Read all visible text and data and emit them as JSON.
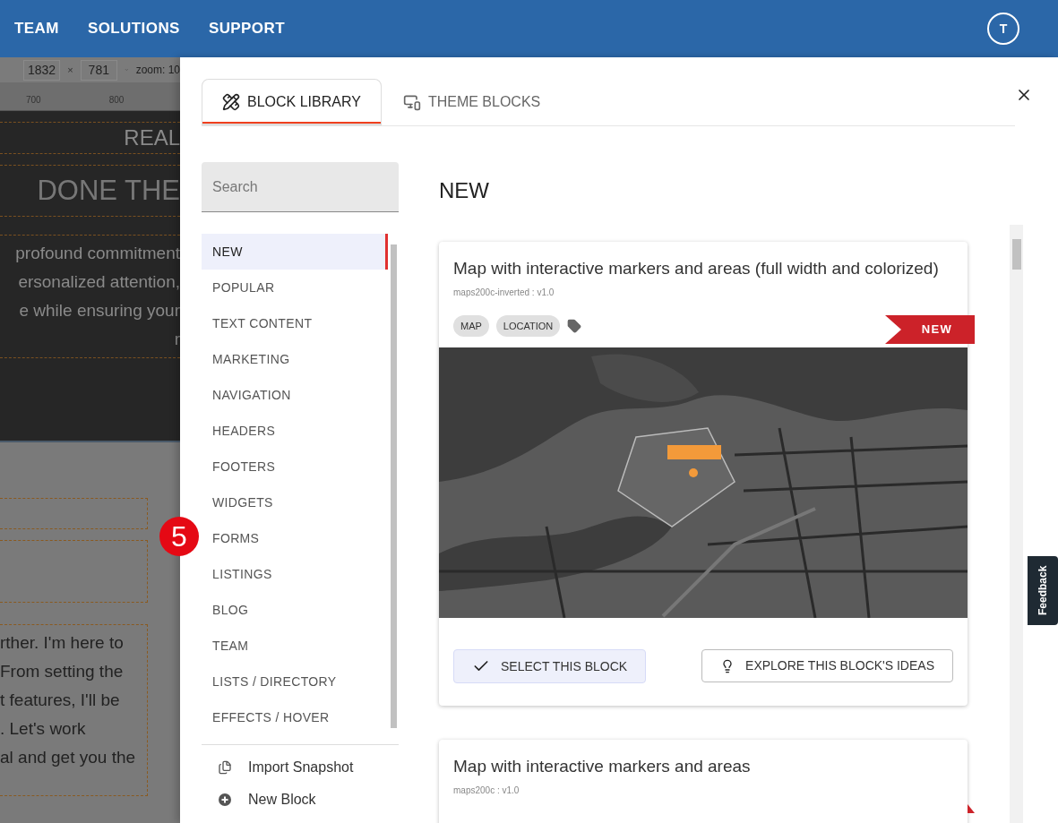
{
  "top_nav": {
    "items": [
      "TEAM",
      "SOLUTIONS",
      "SUPPORT"
    ],
    "avatar": "T"
  },
  "editor_background": {
    "width_field": "1832",
    "times": "×",
    "height_field": "781",
    "zoom": "zoom: 10",
    "ruler_labels": [
      "700",
      "800"
    ],
    "hero_eyebrow": "REAL",
    "hero_title": "DONE THE",
    "hero_lines": [
      "profound commitment",
      "ersonalized attention,",
      "e while ensuring your",
      "r"
    ],
    "body_lines": [
      "rther. I'm here to",
      "From setting the",
      "t features, I'll be",
      ". Let's work",
      "al and get you the"
    ]
  },
  "step_badge": "5",
  "library": {
    "tabs": [
      {
        "label": "BLOCK LIBRARY",
        "selected": true,
        "kind": "library"
      },
      {
        "label": "THEME BLOCKS",
        "selected": false,
        "kind": "theme"
      }
    ],
    "search": {
      "placeholder": "Search"
    },
    "categories": [
      {
        "label": "NEW",
        "selected": true
      },
      {
        "label": "POPULAR",
        "selected": false
      },
      {
        "label": "TEXT CONTENT",
        "selected": false
      },
      {
        "label": "MARKETING",
        "selected": false
      },
      {
        "label": "NAVIGATION",
        "selected": false
      },
      {
        "label": "HEADERS",
        "selected": false
      },
      {
        "label": "FOOTERS",
        "selected": false
      },
      {
        "label": "WIDGETS",
        "selected": false
      },
      {
        "label": "FORMS",
        "selected": false
      },
      {
        "label": "LISTINGS",
        "selected": false
      },
      {
        "label": "BLOG",
        "selected": false
      },
      {
        "label": "TEAM",
        "selected": false
      },
      {
        "label": "LISTS / DIRECTORY",
        "selected": false
      },
      {
        "label": "EFFECTS / HOVER",
        "selected": false
      }
    ],
    "actions": [
      {
        "label": "Import Snapshot",
        "kind": "import"
      },
      {
        "label": "New Block",
        "kind": "new"
      }
    ],
    "section_title": "NEW",
    "blocks": [
      {
        "title": "Map with interactive markers and areas (full width and colorized)",
        "meta": "maps200c-inverted : v1.0",
        "tags": [
          "MAP",
          "LOCATION"
        ],
        "badge": "NEW",
        "preview": {
          "kind": "picture"
        },
        "select_label": "SELECT THIS BLOCK",
        "explore_label": "EXPLORE THIS BLOCK'S IDEAS"
      },
      {
        "title": "Map with interactive markers and areas",
        "meta": "maps200c : v1.0",
        "ribbon": true
      }
    ]
  },
  "feedback": "Feedback"
}
